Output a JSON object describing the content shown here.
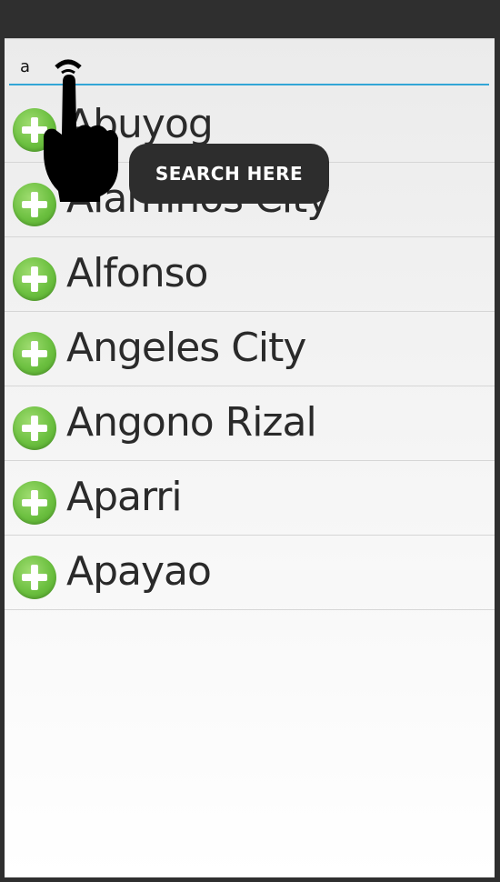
{
  "search": {
    "value": "a",
    "placeholder": ""
  },
  "results": [
    {
      "label": "Abuyog",
      "icon": "add-circle-icon"
    },
    {
      "label": "Alaminos City",
      "icon": "add-circle-icon"
    },
    {
      "label": "Alfonso",
      "icon": "add-circle-icon"
    },
    {
      "label": "Angeles City",
      "icon": "add-circle-icon"
    },
    {
      "label": "Angono Rizal",
      "icon": "add-circle-icon"
    },
    {
      "label": "Aparri",
      "icon": "add-circle-icon"
    },
    {
      "label": "Apayao",
      "icon": "add-circle-icon"
    }
  ],
  "tooltip": {
    "text": "SEARCH HERE"
  },
  "overlay": {
    "icon": "pointing-hand-icon"
  },
  "colors": {
    "accent": "#33a6d6",
    "add": "#6cc040",
    "tooltip_bg": "#2d2d2d"
  }
}
